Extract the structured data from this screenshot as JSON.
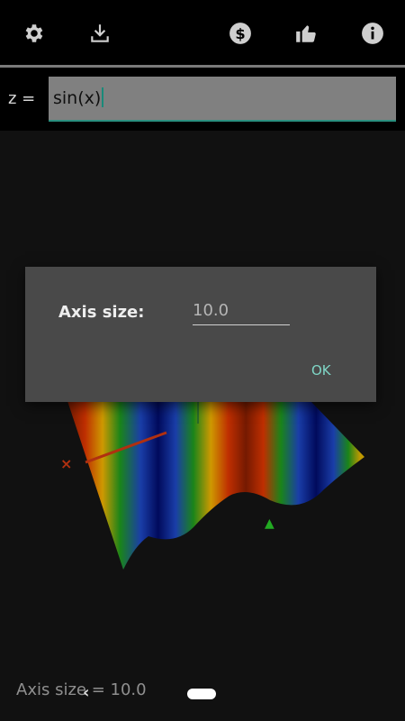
{
  "toolbar": {
    "icons": [
      "gear-icon",
      "download-icon",
      "dollar-icon",
      "thumbs-up-icon",
      "info-icon"
    ]
  },
  "formula": {
    "prefix": "z =",
    "value": "sin(x)"
  },
  "dialog": {
    "label": "Axis size:",
    "value": "10.0",
    "ok_label": "OK"
  },
  "status": {
    "text": "Axis size = 10.0"
  },
  "nav": {
    "back_glyph": "‹"
  },
  "colors": {
    "toolbar_bg": "#000000",
    "input_underline": "#2a8f7f",
    "accent": "#7fd6c6",
    "dialog_bg": "#494949"
  }
}
